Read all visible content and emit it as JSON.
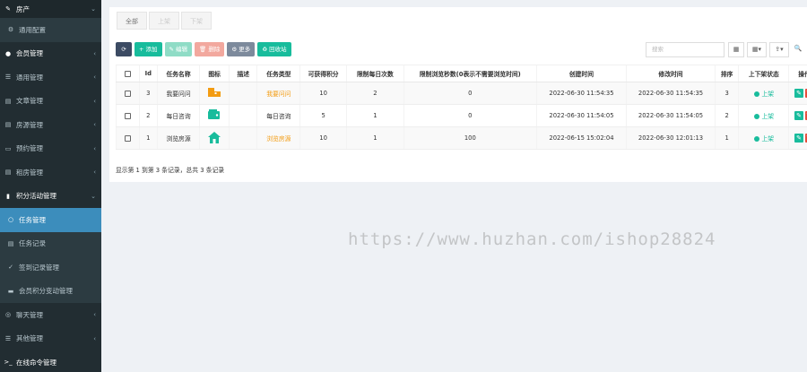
{
  "sidebar": {
    "items": [
      {
        "icon": "tag-icon",
        "glyph": "✎",
        "label": "房产",
        "chev": "⌄",
        "kind": "top"
      },
      {
        "icon": "gear-icon",
        "glyph": "⚙",
        "label": "通用配置",
        "chev": "",
        "kind": "sub"
      },
      {
        "icon": "user-icon",
        "glyph": "●",
        "label": "会员管理",
        "chev": "‹",
        "kind": "hdr"
      },
      {
        "icon": "list-icon",
        "glyph": "☰",
        "label": "通用管理",
        "chev": "‹",
        "kind": ""
      },
      {
        "icon": "file-icon",
        "glyph": "▤",
        "label": "文章管理",
        "chev": "‹",
        "kind": ""
      },
      {
        "icon": "file-icon",
        "glyph": "▤",
        "label": "房源管理",
        "chev": "‹",
        "kind": ""
      },
      {
        "icon": "monitor-icon",
        "glyph": "▭",
        "label": "预约管理",
        "chev": "‹",
        "kind": ""
      },
      {
        "icon": "file-icon",
        "glyph": "▤",
        "label": "租房管理",
        "chev": "‹",
        "kind": ""
      },
      {
        "icon": "chart-icon",
        "glyph": "▮",
        "label": "积分活动管理",
        "chev": "⌄",
        "kind": "hdr"
      },
      {
        "icon": "circle-icon",
        "glyph": "○",
        "label": "任务管理",
        "chev": "",
        "kind": "sub active"
      },
      {
        "icon": "list-icon",
        "glyph": "▤",
        "label": "任务记录",
        "chev": "",
        "kind": "sub"
      },
      {
        "icon": "check-icon",
        "glyph": "✓",
        "label": "签到记录管理",
        "chev": "",
        "kind": "sub"
      },
      {
        "icon": "card-icon",
        "glyph": "▬",
        "label": "会员积分变动管理",
        "chev": "",
        "kind": "sub"
      },
      {
        "icon": "chat-icon",
        "glyph": "◎",
        "label": "聊天管理",
        "chev": "‹",
        "kind": ""
      },
      {
        "icon": "list-icon",
        "glyph": "☰",
        "label": "其他管理",
        "chev": "‹",
        "kind": ""
      },
      {
        "icon": "terminal-icon",
        "glyph": ">_",
        "label": "在线命令管理",
        "chev": "",
        "kind": "hdr"
      }
    ]
  },
  "tabs": [
    "全部",
    "上架",
    "下架"
  ],
  "toolbar": {
    "refresh": "⟳",
    "add": "+ 添加",
    "edit": "✎ 编辑",
    "del": "🗑 删除",
    "more": "⚙ 更多",
    "recycle": "♻ 回收站"
  },
  "search": {
    "placeholder": "搜索"
  },
  "tools": [
    "▦",
    "▦▾",
    "⇪▾",
    "🔍"
  ],
  "table": {
    "headers": [
      "",
      "Id",
      "任务名称",
      "图标",
      "描述",
      "任务类型",
      "可获得积分",
      "限制每日次数",
      "限制浏览秒数(0表示不需要浏览时间)",
      "创建时间",
      "修改时间",
      "排序",
      "上下架状态",
      "操作"
    ],
    "rows": [
      {
        "id": "3",
        "name": "我要问问",
        "icon": "folder-icon",
        "iconColor": "#f39c12",
        "desc": "",
        "type": "我要问问",
        "typeLink": true,
        "points": "10",
        "daily": "2",
        "seconds": "0",
        "created": "2022-06-30 11:54:35",
        "updated": "2022-06-30 11:54:35",
        "sort": "3",
        "status": "上架"
      },
      {
        "id": "2",
        "name": "每日咨询",
        "icon": "wallet-icon",
        "iconColor": "#18bc9c",
        "desc": "",
        "type": "每日咨询",
        "typeLink": false,
        "points": "5",
        "daily": "1",
        "seconds": "0",
        "created": "2022-06-30 11:54:05",
        "updated": "2022-06-30 11:54:05",
        "sort": "2",
        "status": "上架"
      },
      {
        "id": "1",
        "name": "浏览房源",
        "icon": "home-icon",
        "iconColor": "#18bc9c",
        "desc": "",
        "type": "浏览房源",
        "typeLink": true,
        "points": "10",
        "daily": "1",
        "seconds": "100",
        "created": "2022-06-15 15:02:04",
        "updated": "2022-06-30 12:01:13",
        "sort": "1",
        "status": "上架"
      }
    ]
  },
  "summary": "显示第 1 到第 3 条记录，总共 3 条记录",
  "watermark": "https://www.huzhan.com/ishop28824",
  "colors": {
    "accent": "#3c8dbc",
    "success": "#18bc9c",
    "danger": "#e74c3c",
    "warning": "#f39c12",
    "sidebar": "#222d32"
  }
}
